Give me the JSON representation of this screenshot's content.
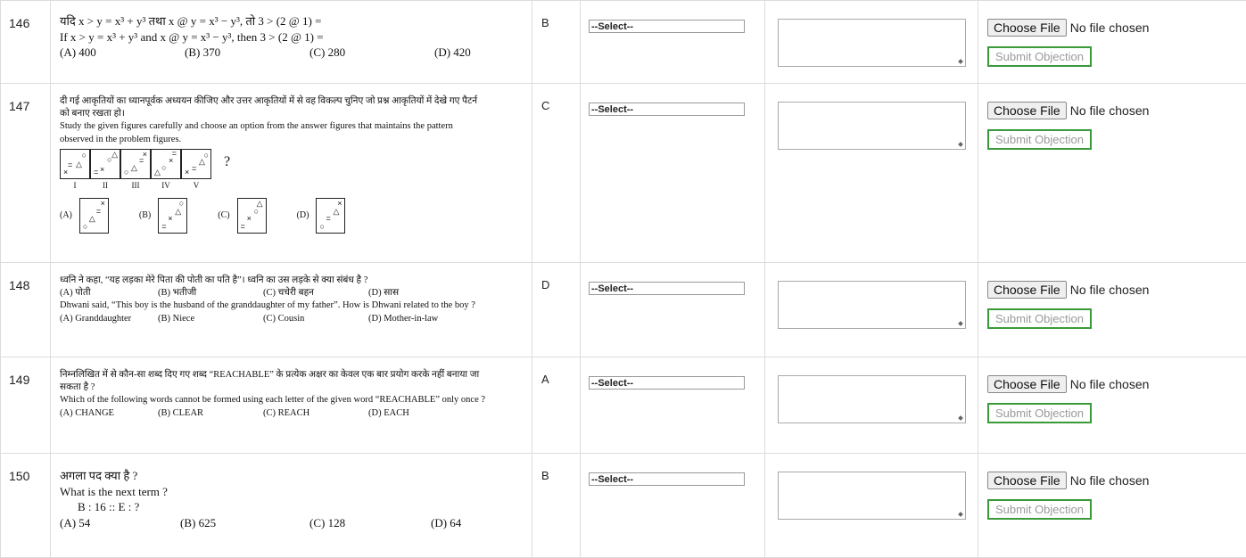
{
  "rows": [
    {
      "num": "146",
      "key": "B",
      "line1": "यदि x > y = x³ + y³ तथा x @ y = x³ − y³, तो 3 > (2 @ 1) =",
      "line2": "If x > y = x³ + y³ and x @ y = x³ − y³, then 3 > (2 @ 1) =",
      "options": [
        "(A)  400",
        "(B)  370",
        "(C)  280",
        "(D)  420"
      ]
    },
    {
      "num": "147",
      "key": "C",
      "line1": "दी गई आकृतियों का ध्यानपूर्वक अध्ययन कीजिए और उत्तर आकृतियों में से वह विकल्प चुनिए जो प्रश्न आकृतियों में देखे गए पैटर्न को बनाए रखता हो।",
      "line2": "Study the given figures carefully and choose an option from the answer figures that maintains the pattern observed in the problem figures.",
      "fig_labels": [
        "I",
        "II",
        "III",
        "IV",
        "V"
      ],
      "qmark": "?",
      "ans_labels": [
        "(A)",
        "(B)",
        "(C)",
        "(D)"
      ]
    },
    {
      "num": "148",
      "key": "D",
      "line1": "ध्वनि ने कहा, “यह लड़का मेरे पिता की पोती का पति है”। ध्वनि का उस लड़के से क्या संबंध है ?",
      "options_hi": [
        "(A)  पोती",
        "(B)  भतीजी",
        "(C)  चचेरी बहन",
        "(D)  सास"
      ],
      "line2": "Dhwani said, “This boy is the husband of the granddaughter of my father”. How is Dhwani related to the boy ?",
      "options": [
        "(A)  Granddaughter",
        "(B)  Niece",
        "(C)  Cousin",
        "(D)  Mother-in-law"
      ]
    },
    {
      "num": "149",
      "key": "A",
      "line1": "निम्नलिखित में से कौन-सा शब्द दिए गए शब्द “REACHABLE” के प्रत्येक अक्षर का केवल एक बार प्रयोग करके नहीं बनाया जा सकता है ?",
      "line2": "Which of the following words cannot be formed using each letter of the given word “REACHABLE” only once ?",
      "options": [
        "(A)  CHANGE",
        "(B)  CLEAR",
        "(C)  REACH",
        "(D)  EACH"
      ]
    },
    {
      "num": "150",
      "key": "B",
      "line1": "अगला पद क्या है ?",
      "line2": "What is the next term ?",
      "line3": "B : 16 :: E : ?",
      "options": [
        "(A)  54",
        "(B)  625",
        "(C)  128",
        "(D)  64"
      ]
    }
  ],
  "controls": {
    "select_label": "--Select--",
    "choose_file": "Choose File",
    "no_file": "No file chosen",
    "submit": "Submit Objection"
  }
}
